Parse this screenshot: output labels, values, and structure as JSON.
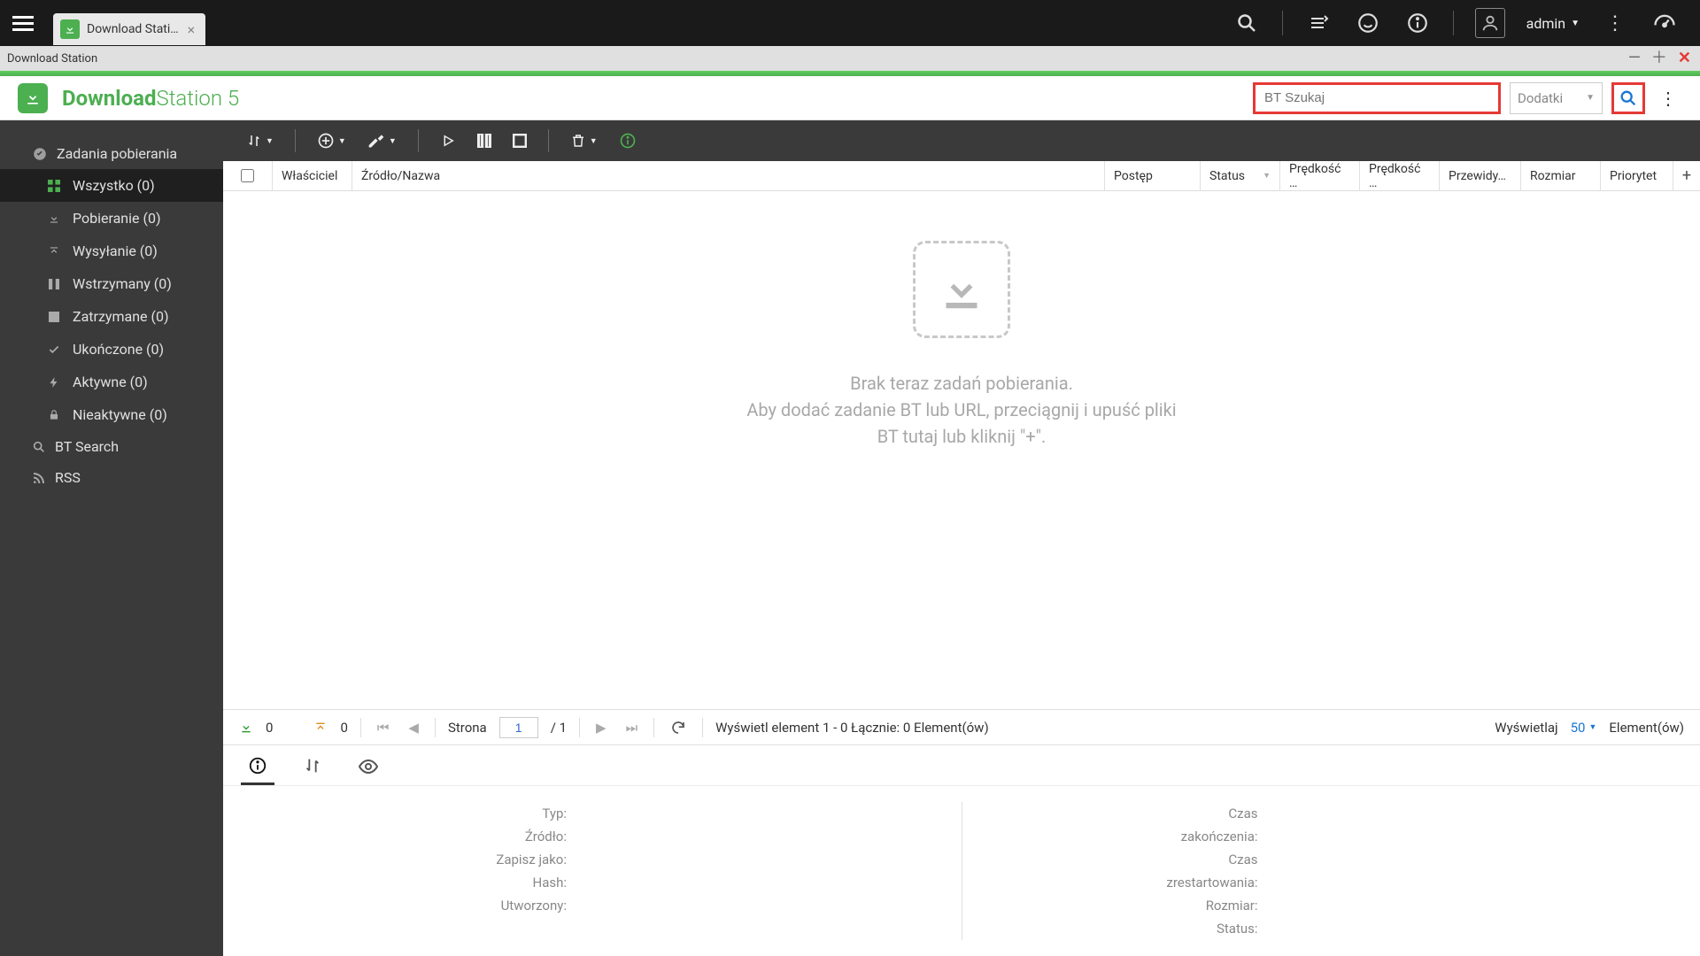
{
  "topbar": {
    "tab_title": "Download Stati…",
    "user": "admin"
  },
  "window": {
    "title": "Download Station"
  },
  "appheader": {
    "title_bold": "Download",
    "title_light": "Station 5",
    "search_placeholder": "BT Szukaj",
    "addons_label": "Dodatki"
  },
  "sidebar": {
    "header": "Zadania pobierania",
    "items": [
      {
        "label": "Wszystko (0)"
      },
      {
        "label": "Pobieranie (0)"
      },
      {
        "label": "Wysyłanie (0)"
      },
      {
        "label": "Wstrzymany (0)"
      },
      {
        "label": "Zatrzymane (0)"
      },
      {
        "label": "Ukończone (0)"
      },
      {
        "label": "Aktywne (0)"
      },
      {
        "label": "Nieaktywne (0)"
      }
    ],
    "bt_search": "BT Search",
    "rss": "RSS"
  },
  "columns": {
    "owner": "Właściciel",
    "source": "Źródło/Nazwa",
    "progress": "Postęp",
    "status": "Status",
    "speed_dl": "Prędkość …",
    "speed_ul": "Prędkość …",
    "eta": "Przewidy…",
    "size": "Rozmiar",
    "priority": "Priorytet"
  },
  "empty": {
    "line1": "Brak teraz zadań pobierania.",
    "line2": "Aby dodać zadanie BT lub URL, przeciągnij i upuść pliki",
    "line3": "BT tutaj lub kliknij \"+\"."
  },
  "pagebar": {
    "dl_count": "0",
    "ul_count": "0",
    "page_label": "Strona",
    "page_current": "1",
    "page_sep": "/ 1",
    "summary": "Wyświetl element 1 - 0 Łącznie: 0 Element(ów)",
    "show_label": "Wyświetlaj",
    "page_size": "50",
    "elements": "Element(ów)"
  },
  "details": {
    "type": "Typ:",
    "source": "Źródło:",
    "saveas": "Zapisz jako:",
    "hash": "Hash:",
    "created": "Utworzony:",
    "finish_time_a": "Czas",
    "finish_time_b": "zakończenia:",
    "restart_time_a": "Czas",
    "restart_time_b": "zrestartowania:",
    "size": "Rozmiar:",
    "status": "Status:"
  }
}
